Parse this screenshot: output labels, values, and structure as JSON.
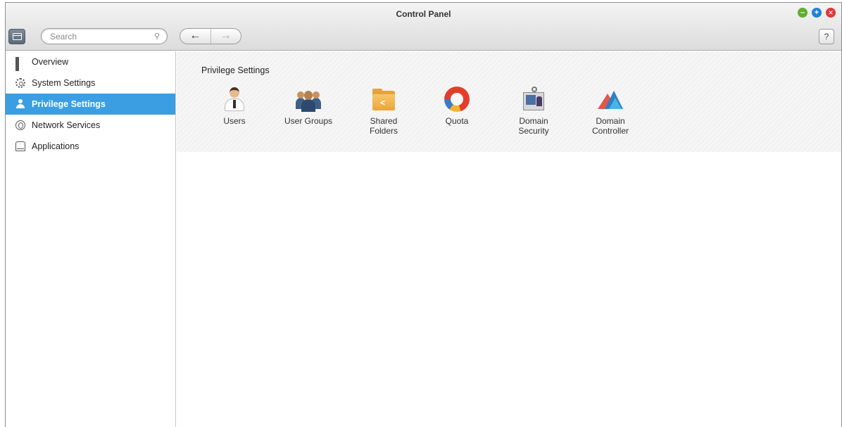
{
  "window": {
    "title": "Control Panel",
    "controls": {
      "minimize_icon": "minimize-icon",
      "maximize_icon": "maximize-icon",
      "close_icon": "close-icon"
    }
  },
  "toolbar": {
    "search": {
      "placeholder": "Search",
      "value": ""
    },
    "back_glyph": "←",
    "forward_glyph": "→",
    "help_label": "?"
  },
  "sidebar": {
    "items": [
      {
        "label": "Overview",
        "icon": "overview-icon"
      },
      {
        "label": "System Settings",
        "icon": "gear-icon"
      },
      {
        "label": "Privilege Settings",
        "icon": "user-icon",
        "active": true
      },
      {
        "label": "Network Services",
        "icon": "network-icon"
      },
      {
        "label": "Applications",
        "icon": "applications-icon"
      }
    ]
  },
  "main": {
    "section_title": "Privilege Settings",
    "apps": [
      {
        "label": "Users",
        "icon": "users-icon"
      },
      {
        "label": "User Groups",
        "icon": "user-groups-icon"
      },
      {
        "label": "Shared\nFolders",
        "icon": "shared-folders-icon"
      },
      {
        "label": "Quota",
        "icon": "quota-icon"
      },
      {
        "label": "Domain\nSecurity",
        "icon": "domain-security-icon"
      },
      {
        "label": "Domain\nController",
        "icon": "domain-controller-icon"
      }
    ]
  },
  "colors": {
    "active_item_bg": "#3b9ee3",
    "minimize": "#5fae2e",
    "maximize": "#1f82d6",
    "close": "#e0393a"
  }
}
